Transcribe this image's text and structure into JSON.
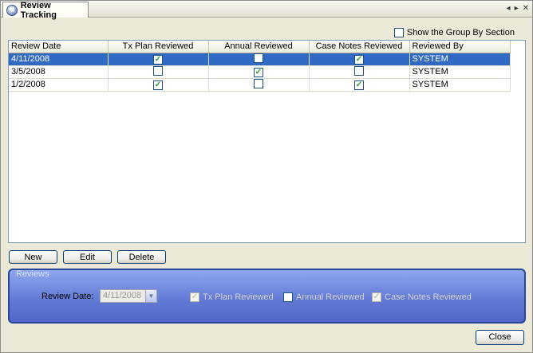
{
  "tab": {
    "title": "Review Tracking",
    "icon": "app-logo-icon"
  },
  "tab_controls": {
    "prev": "◂",
    "next": "▸",
    "close": "✕"
  },
  "groupby": {
    "label": "Show the Group By Section",
    "checked": false
  },
  "grid": {
    "columns": [
      "Review Date",
      "Tx Plan Reviewed",
      "Annual Reviewed",
      "Case Notes Reviewed",
      "Reviewed By"
    ],
    "rows": [
      {
        "date": "4/11/2008",
        "tx": true,
        "annual": false,
        "case": true,
        "by": "SYSTEM",
        "selected": true
      },
      {
        "date": "3/5/2008",
        "tx": false,
        "annual": true,
        "case": false,
        "by": "SYSTEM",
        "selected": false
      },
      {
        "date": "1/2/2008",
        "tx": true,
        "annual": false,
        "case": true,
        "by": "SYSTEM",
        "selected": false
      }
    ]
  },
  "buttons": {
    "new": "New",
    "edit": "Edit",
    "delete": "Delete",
    "close": "Close"
  },
  "reviews": {
    "legend": "Reviews",
    "date_label": "Review Date:",
    "date_value": "4/11/2008",
    "tx_label": "Tx Plan Reviewed",
    "tx_checked": true,
    "annual_label": "Annual Reviewed",
    "annual_checked": false,
    "case_label": "Case Notes Reviewed",
    "case_checked": true
  },
  "colors": {
    "selection": "#316ac5",
    "group_panel": "#6179d5",
    "check": "#21a121"
  }
}
